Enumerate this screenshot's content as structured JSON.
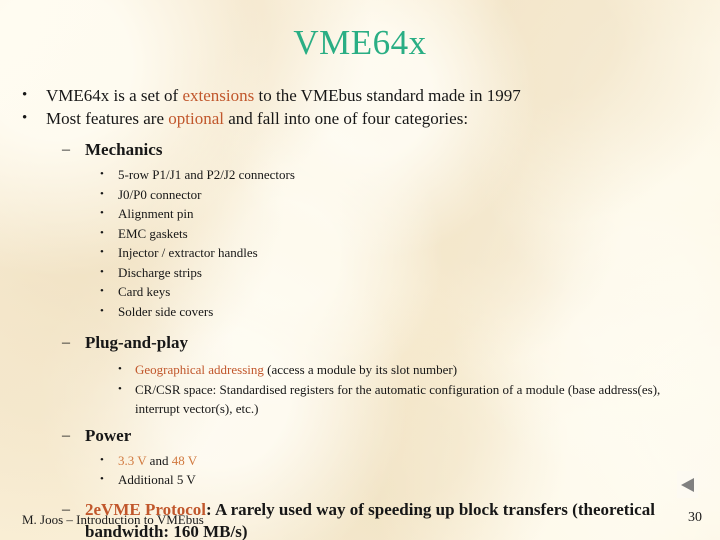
{
  "slide": {
    "title": "VME64x",
    "page_number": "30",
    "footer": "M. Joos – Introduction to VMEbus",
    "background_color": "#faf0d8",
    "title_color": "#2aae84",
    "accent_color": "#c1572c",
    "accent_soft_color": "#d1793f",
    "text_color": "#171717"
  },
  "bullets": {
    "b1": {
      "marker": "•",
      "pre": "VME64x is a set of ",
      "accent": "extensions",
      "post": " to the VMEbus standard made in 1997"
    },
    "b2": {
      "marker": "•",
      "pre": "Most features are ",
      "accent": "optional",
      "post": " and fall into one of four categories:"
    }
  },
  "sections": {
    "mechanics": {
      "marker": "–",
      "heading": "Mechanics",
      "items": [
        "5-row P1/J1 and P2/J2 connectors",
        "J0/P0 connector",
        "Alignment pin",
        "EMC gaskets",
        "Injector / extractor handles",
        "Discharge strips",
        "Card keys",
        "Solder side covers"
      ],
      "item_marker": "•"
    },
    "plug_and_play": {
      "marker": "–",
      "heading": "Plug-and-play",
      "item_marker": "•",
      "item1": {
        "accent": "Geographical addressing",
        "post": " (access a module by its slot number)"
      },
      "item2": {
        "text": "CR/CSR space: Standardised registers for the automatic configuration of a module (base address(es), interrupt vector(s), etc.)"
      }
    },
    "power": {
      "marker": "–",
      "heading": "Power",
      "item_marker": "•",
      "item1": {
        "accent1": "3.3 V",
        "mid": " and ",
        "accent2": "48 V"
      },
      "item2": {
        "text": "Additional 5 V"
      }
    },
    "protocol_2evme": {
      "marker": "–",
      "accent": "2eVME Protocol",
      "post": ": A rarely used way of speeding up block transfers (theoretical bandwidth: 160 MB/s)"
    }
  },
  "nav": {
    "back_arrow_icon": "triangle-left-icon",
    "arrow_color": "#808080"
  }
}
